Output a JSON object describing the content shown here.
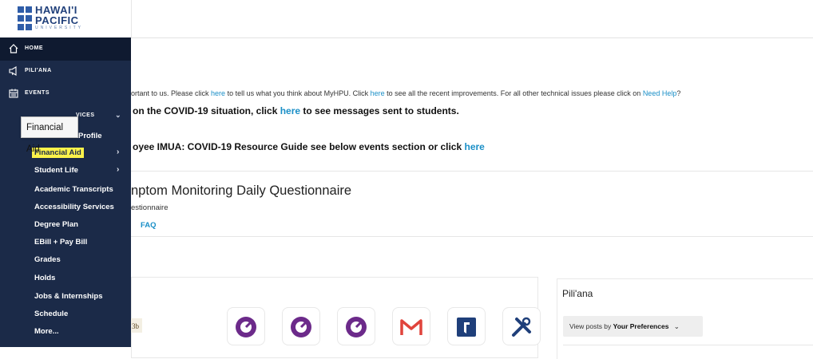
{
  "logo": {
    "line1": "HAWAI'I",
    "line2": "PACIFIC",
    "line3": "UNIVERSITY"
  },
  "sidebar": {
    "main": [
      {
        "label": "HOME",
        "icon": "home-icon"
      },
      {
        "label": "PILI'ANA",
        "icon": "megaphone-icon"
      },
      {
        "label": "EVENTS",
        "icon": "calendar-icon"
      },
      {
        "label": "VICES",
        "icon": "services-icon",
        "chevron": "⌄"
      }
    ],
    "sub": [
      {
        "label": "Profile",
        "arrow": ""
      },
      {
        "label": "Financial Aid",
        "arrow": "›"
      },
      {
        "label": "Student Life",
        "arrow": "›"
      },
      {
        "label": "Academic Transcripts",
        "arrow": ""
      },
      {
        "label": "Accessibility Services",
        "arrow": ""
      },
      {
        "label": "Degree Plan",
        "arrow": ""
      },
      {
        "label": "EBill + Pay Bill",
        "arrow": ""
      },
      {
        "label": "Grades",
        "arrow": ""
      },
      {
        "label": "Holds",
        "arrow": ""
      },
      {
        "label": "Jobs & Internships",
        "arrow": ""
      },
      {
        "label": "Schedule",
        "arrow": ""
      },
      {
        "label": "More...",
        "arrow": ""
      }
    ],
    "tooltip": "Financial Aid"
  },
  "announcements": {
    "line1_a": "ortant to us. Please click ",
    "line1_here1": "here",
    "line1_b": " to tell us what you think about MyHPU. Click ",
    "line1_here2": "here",
    "line1_c": " to see all the recent improvements. For all other technical issues please click on ",
    "line1_need_help": "Need Help",
    "line1_d": "?",
    "line2_a": "on the COVID-19 situation, click ",
    "line2_here": "here",
    "line2_b": " to see messages sent to students.",
    "line3_a": "oyee IMUA: COVID-19 Resource Guide see below events section or click ",
    "line3_here": "here"
  },
  "questionnaire": {
    "title": "nptom Monitoring Daily Questionnaire",
    "subtitle": "estionnaire",
    "faq": "FAQ"
  },
  "apps": [
    {
      "icon": "partial-app-icon",
      "color": "#8b6a2b"
    },
    {
      "icon": "timer-app-icon",
      "color": "#6c2a8a"
    },
    {
      "icon": "timer-app-icon",
      "color": "#6c2a8a"
    },
    {
      "icon": "timer-app-icon",
      "color": "#6c2a8a"
    },
    {
      "icon": "gmail-icon",
      "color": "#e0443c"
    },
    {
      "icon": "bookmark-app-icon",
      "color": "#1f3f7a"
    },
    {
      "icon": "tools-icon",
      "color": "#1f3f7a"
    }
  ],
  "piliana": {
    "title": "Pili'ana",
    "view_posts_by": "View posts by ",
    "preference": "Your Preferences",
    "chevron": "⌄"
  }
}
